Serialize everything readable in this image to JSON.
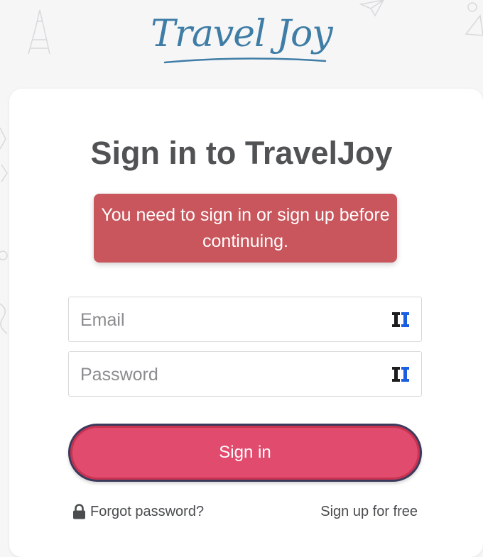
{
  "brand": {
    "logo_text": "Travel Joy",
    "color": "#3f7da6"
  },
  "page": {
    "title": "Sign in to TravelJoy"
  },
  "alert": {
    "message": "You need to sign in or sign up before continuing.",
    "color": "#c8565c"
  },
  "form": {
    "email": {
      "placeholder": "Email",
      "value": ""
    },
    "password": {
      "placeholder": "Password",
      "value": ""
    },
    "field_icon": "password-manager-icon",
    "submit_label": "Sign in",
    "submit_color": "#e04b6e"
  },
  "links": {
    "forgot_password": "Forgot password?",
    "forgot_icon": "lock-icon",
    "signup": "Sign up for free"
  }
}
